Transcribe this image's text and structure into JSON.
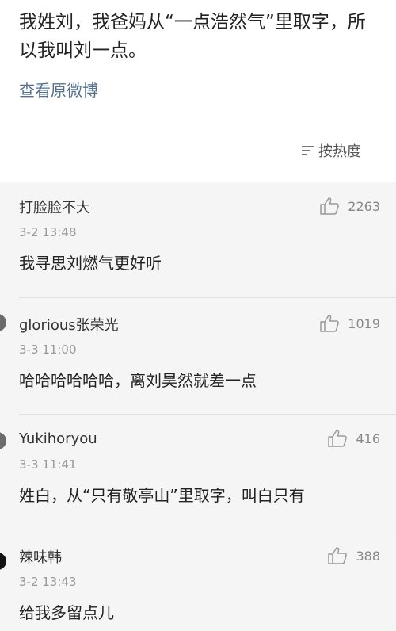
{
  "post": {
    "text": "我姓刘，我爸妈从“一点浩然气”里取字，所以我叫刘一点。",
    "view_original": "查看原微博",
    "sort_label": "按热度",
    "sort_icon": "sort-lines-icon"
  },
  "comments": [
    {
      "user": "打脸脸不大",
      "time": "3-2 13:48",
      "text": "我寻思刘燃气更好听",
      "likes": "2263"
    },
    {
      "user": "glorious张荣光",
      "time": "3-3 11:00",
      "text": "哈哈哈哈哈哈，离刘昊然就差一点",
      "likes": "1019"
    },
    {
      "user": "Yukihoryou",
      "time": "3-3 11:41",
      "text": "姓白，从“只有敬亭山”里取字，叫白只有",
      "likes": "416"
    },
    {
      "user": "辣味韩",
      "time": "3-2 13:43",
      "text": "给我多留点儿",
      "likes": "388"
    }
  ],
  "colors": {
    "link": "#55708f",
    "comment_bg": "#f5f5f5",
    "meta": "#999999"
  }
}
